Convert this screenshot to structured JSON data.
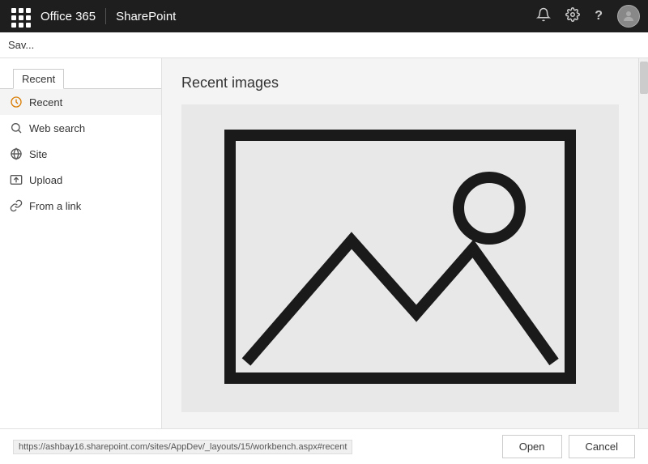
{
  "topbar": {
    "app_title": "Office 365",
    "divider": "|",
    "app_name": "SharePoint",
    "icons": {
      "bell": "🔔",
      "gear": "⚙",
      "help": "?"
    }
  },
  "toolbar": {
    "save_label": "Sav..."
  },
  "sidebar": {
    "tab_label": "Recent",
    "items": [
      {
        "id": "recent",
        "label": "Recent",
        "icon": "recent",
        "active": true
      },
      {
        "id": "web-search",
        "label": "Web search",
        "icon": "search",
        "active": false
      },
      {
        "id": "site",
        "label": "Site",
        "icon": "site",
        "active": false
      },
      {
        "id": "upload",
        "label": "Upload",
        "icon": "upload",
        "active": false
      },
      {
        "id": "from-a-link",
        "label": "From a link",
        "icon": "link",
        "active": false
      }
    ]
  },
  "main": {
    "title": "Recent images"
  },
  "bottom": {
    "url": "https://ashbay16.sharepoint.com/sites/AppDev/_layouts/15/workbench.aspx#recent",
    "open_label": "Open",
    "cancel_label": "Cancel"
  }
}
